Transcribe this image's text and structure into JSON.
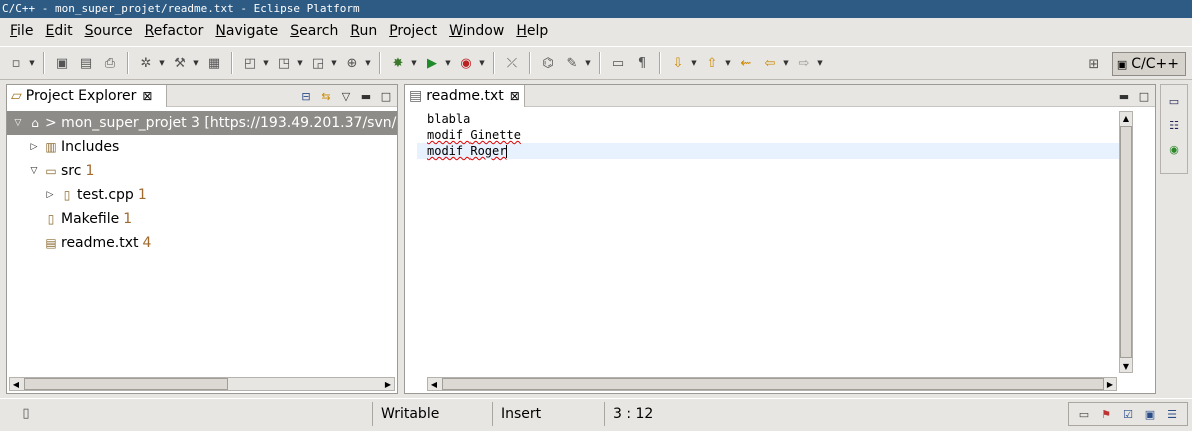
{
  "window": {
    "title": "C/C++ - mon_super_projet/readme.txt - Eclipse Platform"
  },
  "menubar": {
    "items": [
      {
        "label": "File"
      },
      {
        "label": "Edit"
      },
      {
        "label": "Source"
      },
      {
        "label": "Refactor"
      },
      {
        "label": "Navigate"
      },
      {
        "label": "Search"
      },
      {
        "label": "Run"
      },
      {
        "label": "Project"
      },
      {
        "label": "Window"
      },
      {
        "label": "Help"
      }
    ]
  },
  "toolbar": {
    "perspective_label": "C/C++"
  },
  "project_explorer": {
    "tab_label": "Project Explorer",
    "tree": [
      {
        "label": "> mon_super_projet 3 [https://193.49.201.37/svn/",
        "badge": "",
        "depth": 0,
        "expanded": true,
        "selected": true,
        "icon": "project-icon"
      },
      {
        "label": "Includes",
        "badge": "",
        "depth": 1,
        "expanded": false,
        "selected": false,
        "icon": "includes-icon"
      },
      {
        "label": "src",
        "badge": "1",
        "depth": 1,
        "expanded": true,
        "selected": false,
        "icon": "folder-icon"
      },
      {
        "label": "test.cpp",
        "badge": "1",
        "depth": 2,
        "expanded": false,
        "selected": false,
        "icon": "cpp-file-icon"
      },
      {
        "label": "Makefile",
        "badge": "1",
        "depth": 1,
        "expanded": null,
        "selected": false,
        "icon": "makefile-icon"
      },
      {
        "label": "readme.txt",
        "badge": "4",
        "depth": 1,
        "expanded": null,
        "selected": false,
        "icon": "text-file-icon"
      }
    ]
  },
  "editor": {
    "tab_label": "readme.txt",
    "lines": [
      {
        "text": "blabla",
        "current": false
      },
      {
        "pre": "modif ",
        "spell": "Ginette",
        "current": false
      },
      {
        "pre": "modif ",
        "spell": "Roger",
        "current": true
      }
    ]
  },
  "statusbar": {
    "mode": "Writable",
    "insert": "Insert",
    "position": "3 : 12"
  }
}
